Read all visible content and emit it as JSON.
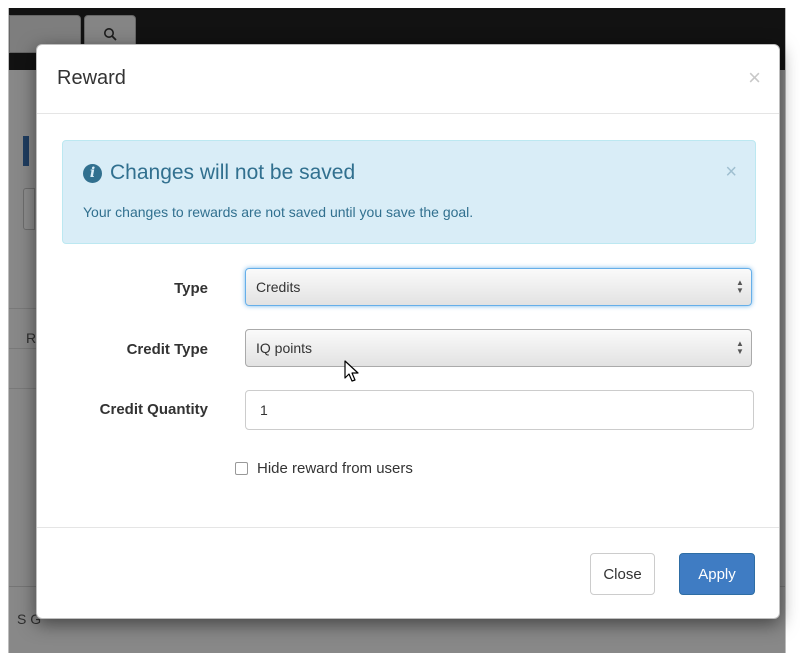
{
  "modal": {
    "title": "Reward",
    "close_icon": "×"
  },
  "alert": {
    "icon": "info-circle-icon",
    "title": "Changes will not be saved",
    "text": "Your changes to rewards are not saved until you save the goal.",
    "close_icon": "×"
  },
  "form": {
    "type_label": "Type",
    "type_value": "Credits",
    "credit_type_label": "Credit Type",
    "credit_type_value": "IQ points",
    "credit_quantity_label": "Credit Quantity",
    "credit_quantity_value": "1",
    "hide_reward_label": "Hide reward from users"
  },
  "footer": {
    "close_label": "Close",
    "apply_label": "Apply"
  },
  "background": {
    "letter_r": "R",
    "letter_s": "S G"
  },
  "colors": {
    "primary": "#3f7cc3",
    "alert_bg": "#d9edf7",
    "alert_text": "#31708f"
  }
}
